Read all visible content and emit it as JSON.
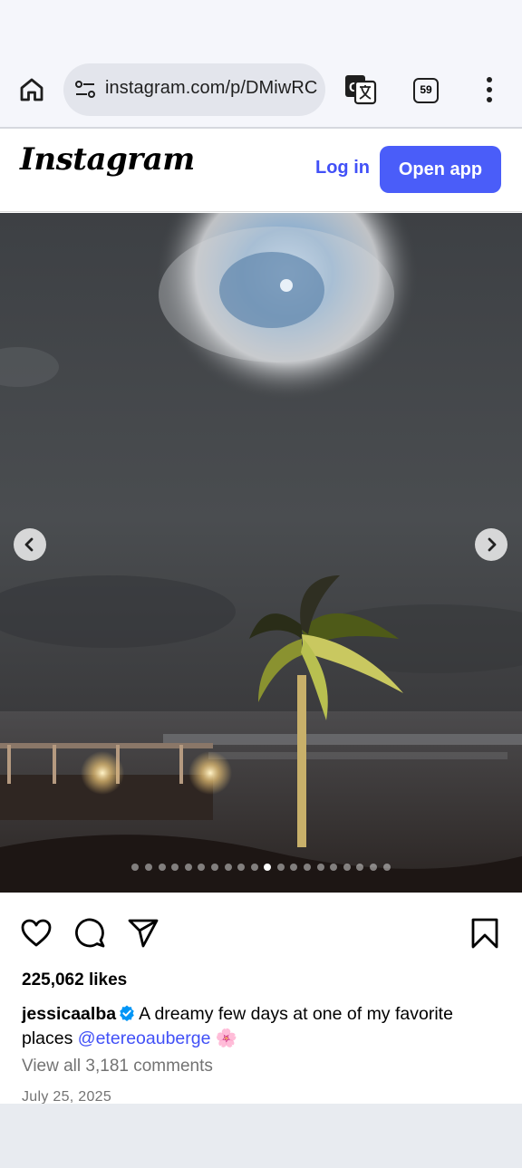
{
  "browser": {
    "url": "instagram.com/p/DMiwRC",
    "tab_count": "59",
    "icons": [
      "home-icon",
      "site-settings-icon",
      "translate-icon",
      "tabs-icon",
      "more-vert-icon"
    ]
  },
  "header": {
    "logo_text": "Instagram",
    "login_label": "Log in",
    "open_app_label": "Open app"
  },
  "carousel": {
    "slide_count": 20,
    "active_index": 10
  },
  "post": {
    "likes": "225,062 likes",
    "username": "jessicaalba",
    "caption_text": "A dreamy few days at one of my favorite places",
    "mention": "@etereoauberge",
    "emoji": "🌸",
    "view_comments": "View all 3,181 comments",
    "date": "July 25, 2025"
  },
  "colors": {
    "accent": "#4a5df9",
    "link": "#4150f7",
    "verified": "#0095f6",
    "muted_text": "#737373"
  }
}
